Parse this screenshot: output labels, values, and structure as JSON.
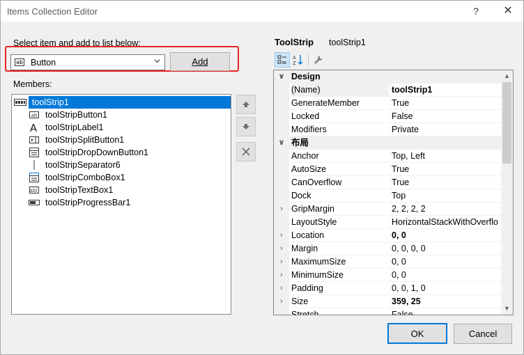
{
  "window": {
    "title": "Items Collection Editor",
    "help": "?",
    "close": "✕"
  },
  "select_label": "Select item and add to list below:",
  "combo": {
    "icon_text": "ab",
    "value": "Button"
  },
  "add_button": "Add",
  "members_label": "Members:",
  "members": {
    "root": "toolStrip1",
    "root_icon": "toolstrip-icon",
    "items": [
      {
        "label": "toolStripButton1",
        "icon": "button-icon"
      },
      {
        "label": "toolStripLabel1",
        "icon": "label-icon"
      },
      {
        "label": "toolStripSplitButton1",
        "icon": "split-button-icon"
      },
      {
        "label": "toolStripDropDownButton1",
        "icon": "dropdown-button-icon"
      },
      {
        "label": "toolStripSeparator6",
        "icon": "separator-icon"
      },
      {
        "label": "toolStripComboBox1",
        "icon": "combobox-icon"
      },
      {
        "label": "toolStripTextBox1",
        "icon": "textbox-icon"
      },
      {
        "label": "toolStripProgressBar1",
        "icon": "progressbar-icon"
      }
    ]
  },
  "properties": {
    "type": "ToolStrip",
    "name": "toolStrip1",
    "categories": [
      {
        "name": "Design",
        "expanded": true,
        "rows": [
          {
            "name": "(Name)",
            "value": "toolStrip1",
            "bold": true,
            "expandable": false,
            "selected": true
          },
          {
            "name": "GenerateMember",
            "value": "True",
            "bold": false,
            "expandable": false
          },
          {
            "name": "Locked",
            "value": "False",
            "bold": false,
            "expandable": false
          },
          {
            "name": "Modifiers",
            "value": "Private",
            "bold": false,
            "expandable": false
          }
        ]
      },
      {
        "name": "布局",
        "expanded": true,
        "rows": [
          {
            "name": "Anchor",
            "value": "Top, Left",
            "bold": false,
            "expandable": false
          },
          {
            "name": "AutoSize",
            "value": "True",
            "bold": false,
            "expandable": false
          },
          {
            "name": "CanOverflow",
            "value": "True",
            "bold": false,
            "expandable": false
          },
          {
            "name": "Dock",
            "value": "Top",
            "bold": false,
            "expandable": false
          },
          {
            "name": "GripMargin",
            "value": "2, 2, 2, 2",
            "bold": false,
            "expandable": true
          },
          {
            "name": "LayoutStyle",
            "value": "HorizontalStackWithOverflo",
            "bold": false,
            "expandable": false
          },
          {
            "name": "Location",
            "value": "0, 0",
            "bold": true,
            "expandable": true
          },
          {
            "name": "Margin",
            "value": "0, 0, 0, 0",
            "bold": false,
            "expandable": true
          },
          {
            "name": "MaximumSize",
            "value": "0, 0",
            "bold": false,
            "expandable": true
          },
          {
            "name": "MinimumSize",
            "value": "0, 0",
            "bold": false,
            "expandable": true
          },
          {
            "name": "Padding",
            "value": "0, 0, 1, 0",
            "bold": false,
            "expandable": true
          },
          {
            "name": "Size",
            "value": "359, 25",
            "bold": true,
            "expandable": true
          },
          {
            "name": "Stretch",
            "value": "False",
            "bold": false,
            "expandable": false
          }
        ]
      }
    ]
  },
  "ok_button": "OK",
  "cancel_button": "Cancel",
  "colors": {
    "selection": "#0078d7",
    "highlight_border": "#e8211f"
  }
}
